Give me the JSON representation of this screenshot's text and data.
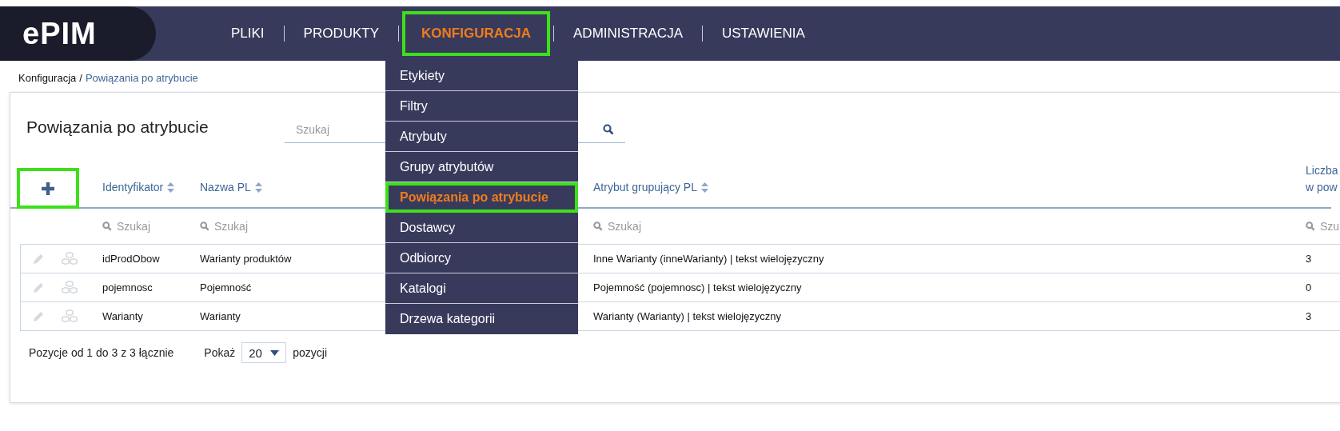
{
  "logo": "ePIM",
  "nav": [
    {
      "label": "PLIKI",
      "selected": false,
      "highlighted": false
    },
    {
      "label": "PRODUKTY",
      "selected": false,
      "highlighted": false
    },
    {
      "label": "KONFIGURACJA",
      "selected": true,
      "highlighted": true
    },
    {
      "label": "ADMINISTRACJA",
      "selected": false,
      "highlighted": false
    },
    {
      "label": "USTAWIENIA",
      "selected": false,
      "highlighted": false
    }
  ],
  "breadcrumb": {
    "parent": "Konfiguracja",
    "separator": "/",
    "current": "Powiązania po atrybucie"
  },
  "dropdown": [
    {
      "label": "Etykiety",
      "selected": false,
      "highlighted": false
    },
    {
      "label": "Filtry",
      "selected": false,
      "highlighted": false
    },
    {
      "label": "Atrybuty",
      "selected": false,
      "highlighted": false
    },
    {
      "label": "Grupy atrybutów",
      "selected": false,
      "highlighted": false
    },
    {
      "label": "Powiązania po atrybucie",
      "selected": true,
      "highlighted": true
    },
    {
      "label": "Dostawcy",
      "selected": false,
      "highlighted": false
    },
    {
      "label": "Odbiorcy",
      "selected": false,
      "highlighted": false
    },
    {
      "label": "Katalogi",
      "selected": false,
      "highlighted": false
    },
    {
      "label": "Drzewa kategorii",
      "selected": false,
      "highlighted": false
    }
  ],
  "page_title": "Powiązania po atrybucie",
  "search": {
    "placeholder": "Szukaj"
  },
  "add_button_highlighted": true,
  "table": {
    "columns": [
      {
        "lines": [
          "Identyfikator"
        ],
        "sortable": true,
        "filter": "Szukaj"
      },
      {
        "lines": [
          "Nazwa PL"
        ],
        "sortable": true,
        "filter": "Szukaj"
      },
      {
        "sortable": false
      },
      {
        "lines": [
          "Atrybut grupujący PL"
        ],
        "sortable": true,
        "filter": "Szukaj"
      },
      {
        "lines": [
          "Liczba",
          "w pow"
        ],
        "sortable": false,
        "filter": "Szu"
      }
    ],
    "rows": [
      [
        "idProdObow",
        "Warianty produktów",
        "",
        "Inne Warianty (inneWarianty) | tekst wielojęzyczny",
        "3"
      ],
      [
        "pojemnosc",
        "Pojemność",
        "",
        "Pojemność (pojemnosc) | tekst wielojęzyczny",
        "0"
      ],
      [
        "Warianty",
        "Warianty",
        "",
        "Warianty (Warianty) | tekst wielojęzyczny",
        "3"
      ]
    ]
  },
  "footer": {
    "summary": "Pozycje od 1 do 3 z 3 łącznie",
    "show_label": "Pokaż",
    "page_size": "20",
    "suffix": "pozycji"
  }
}
